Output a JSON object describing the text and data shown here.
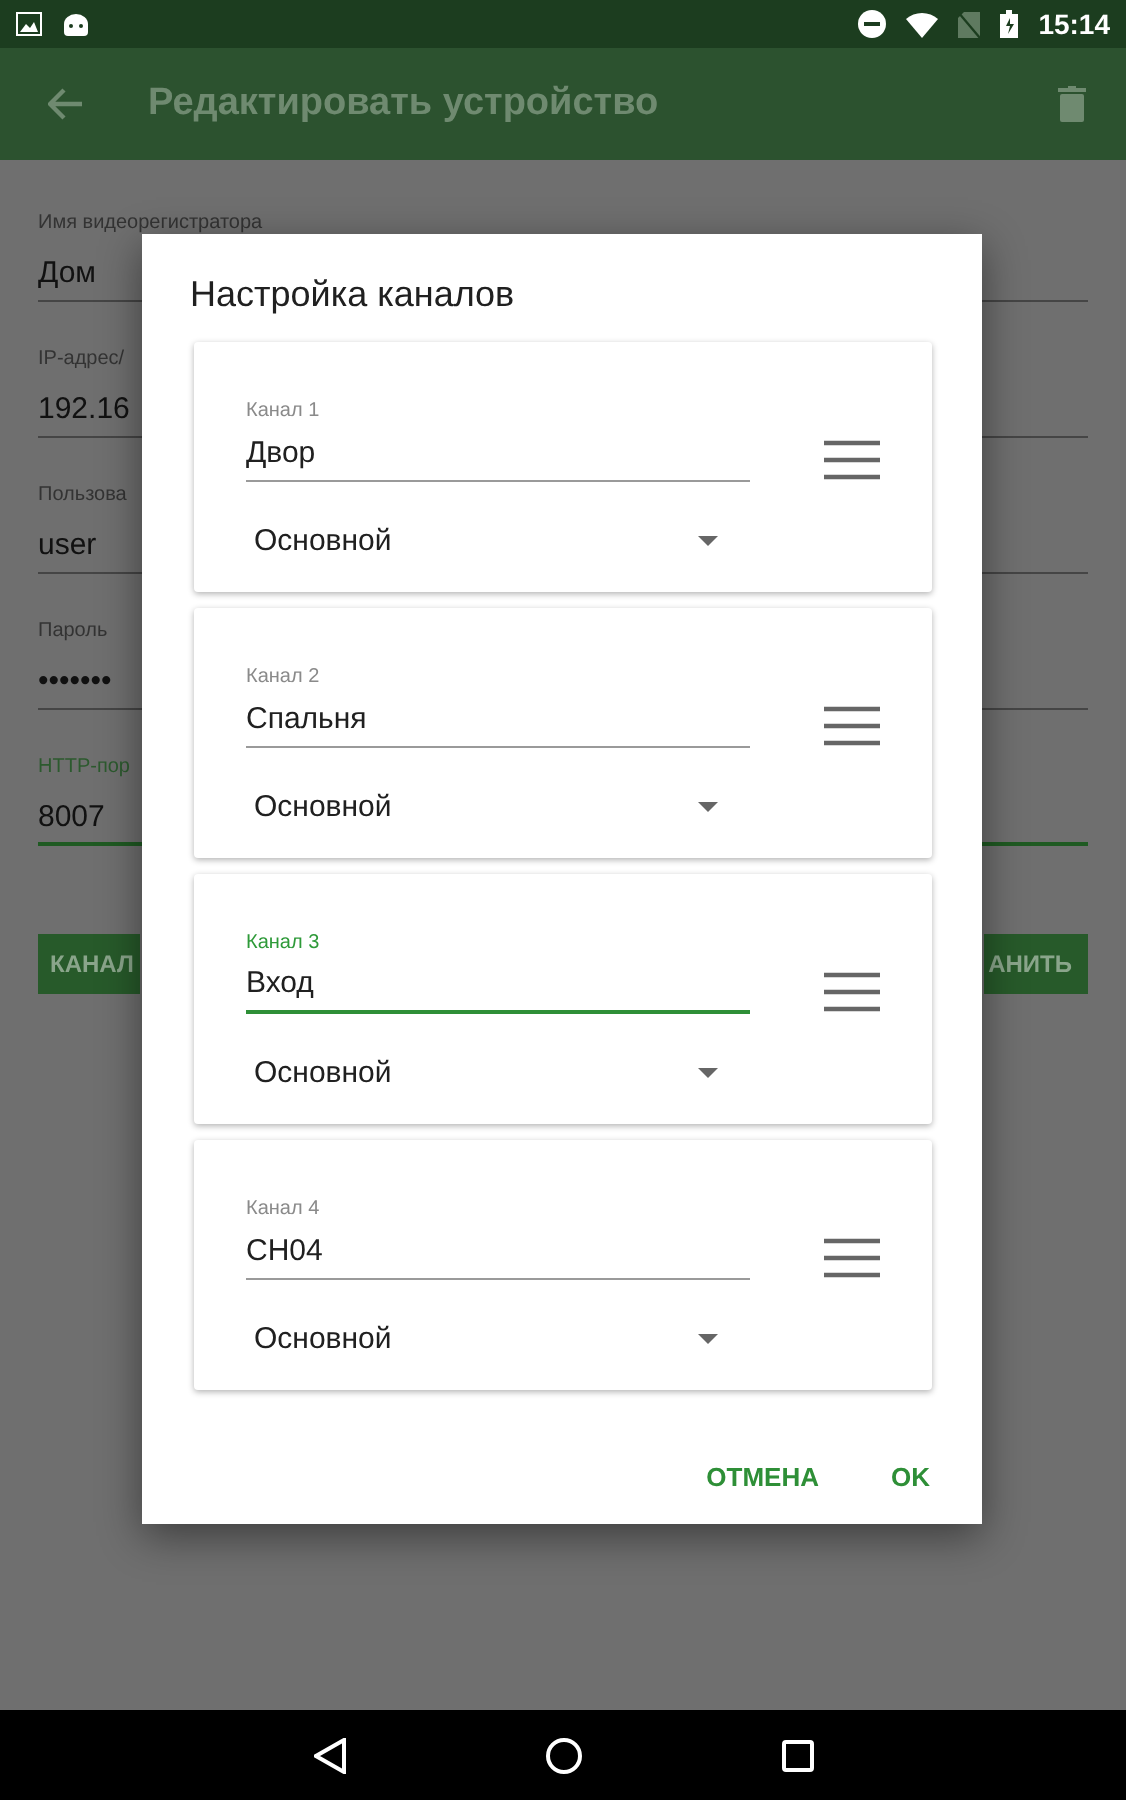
{
  "status_bar": {
    "time": "15:14"
  },
  "app_bar": {
    "title": "Редактировать устройство"
  },
  "form": {
    "fields": [
      {
        "label": "Имя видеорегистратора",
        "value": "Дом",
        "focused": false
      },
      {
        "label": "IP-адрес/",
        "value": "192.16",
        "focused": false
      },
      {
        "label": "Пользова",
        "value": "user",
        "focused": false
      },
      {
        "label": "Пароль",
        "value": "•••••••",
        "focused": false
      },
      {
        "label": "HTTP-пор",
        "value": "8007",
        "focused": true
      }
    ],
    "buttons": [
      "КАНАЛ",
      "АНИТЬ"
    ]
  },
  "dialog": {
    "title": "Настройка каналов",
    "channels": [
      {
        "label": "Канал 1",
        "value": "Двор",
        "type": "Основной",
        "focused": false
      },
      {
        "label": "Канал 2",
        "value": "Спальня",
        "type": "Основной",
        "focused": false
      },
      {
        "label": "Канал 3",
        "value": "Вход",
        "type": "Основной",
        "focused": true
      },
      {
        "label": "Канал 4",
        "value": "CH04",
        "type": "Основной",
        "focused": false
      }
    ],
    "buttons": [
      "ОТМЕНА",
      "OK"
    ]
  }
}
